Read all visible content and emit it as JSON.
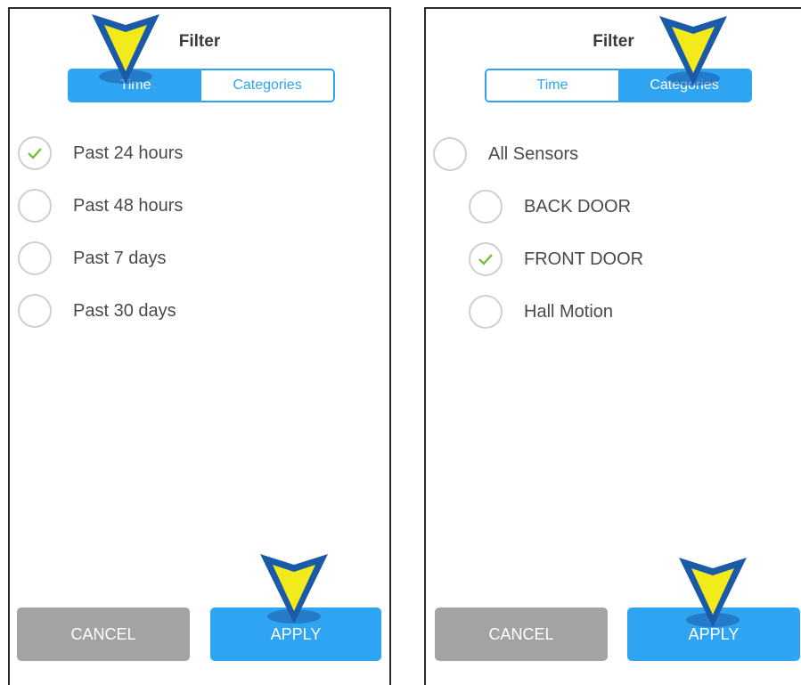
{
  "panels": [
    {
      "title": "Filter",
      "tabs": [
        {
          "label": "Time",
          "active": true
        },
        {
          "label": "Categories",
          "active": false
        }
      ],
      "options": [
        {
          "label": "Past 24 hours",
          "checked": true
        },
        {
          "label": "Past 48 hours",
          "checked": false
        },
        {
          "label": "Past 7 days",
          "checked": false
        },
        {
          "label": "Past 30 days",
          "checked": false
        }
      ],
      "cancel_label": "CANCEL",
      "apply_label": "APPLY"
    },
    {
      "title": "Filter",
      "tabs": [
        {
          "label": "Time",
          "active": false
        },
        {
          "label": "Categories",
          "active": true
        }
      ],
      "options": [
        {
          "label": "All Sensors",
          "checked": false
        },
        {
          "label": "BACK DOOR",
          "checked": false
        },
        {
          "label": "FRONT DOOR",
          "checked": true
        },
        {
          "label": "Hall Motion",
          "checked": false
        }
      ],
      "cancel_label": "CANCEL",
      "apply_label": "APPLY"
    }
  ],
  "colors": {
    "accent": "#2ea4f2",
    "cancel": "#a3a3a3",
    "check": "#6cbf2a",
    "pointer_outer": "#1b5aa8",
    "pointer_inner": "#f3ea1c"
  },
  "annotations": {
    "pointer_icon": "down-arrow-pointer-icon"
  }
}
